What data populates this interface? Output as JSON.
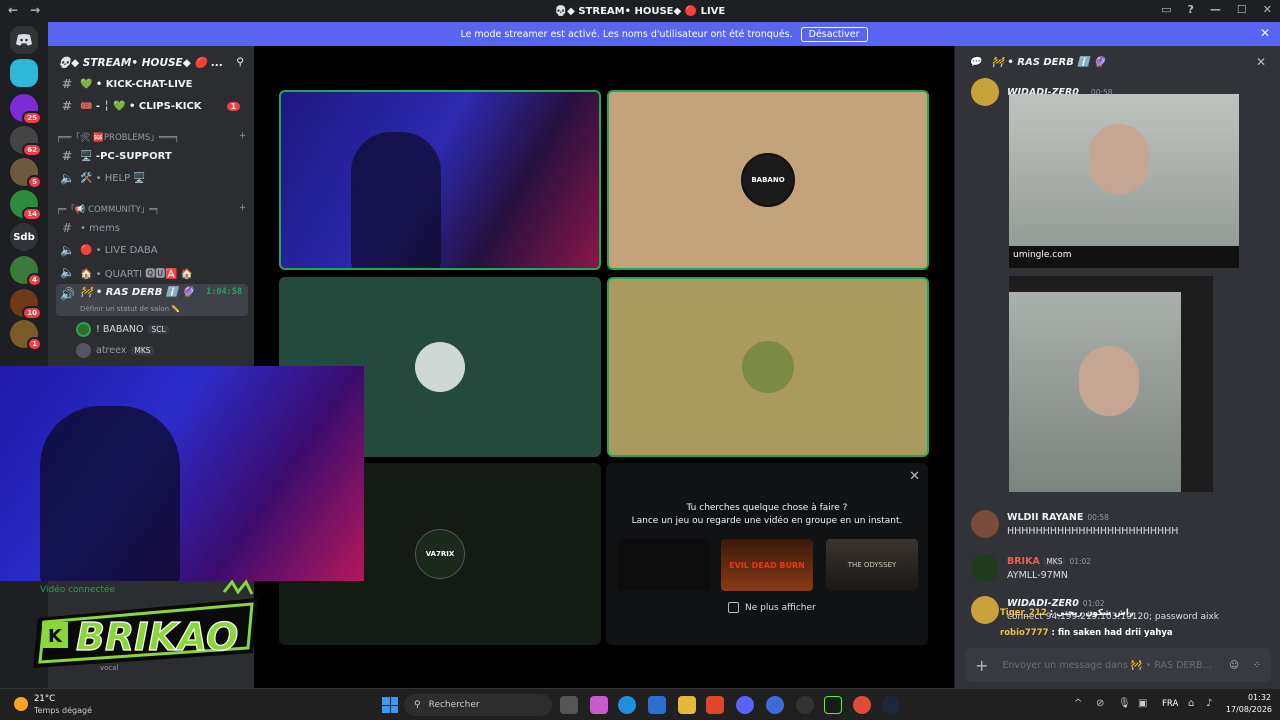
{
  "window": {
    "title": "💀◆ STREAM• HOUSE◆ 🔴 LIVE"
  },
  "banner": {
    "text": "Le mode streamer est activé. Les noms d'utilisateur ont été tronqués.",
    "button": "Désactiver"
  },
  "guilds": [
    {
      "label": "",
      "color": "#2fb7d6",
      "badge": ""
    },
    {
      "label": "",
      "color": "#7d2ad8",
      "badge": "25"
    },
    {
      "label": "",
      "color": "#444",
      "badge": "62"
    },
    {
      "label": "",
      "color": "#6b5a3c",
      "badge": "5"
    },
    {
      "label": "",
      "color": "#2e8b3e",
      "badge": "14"
    },
    {
      "label": "Sdb",
      "color": "#313338",
      "badge": ""
    },
    {
      "label": "",
      "color": "#3c7a3a",
      "badge": "4"
    },
    {
      "label": "",
      "color": "#6e3a1a",
      "badge": "10"
    },
    {
      "label": "",
      "color": "#7a5c2a",
      "badge": "1"
    }
  ],
  "server": {
    "name": "💀◆ STREAM• HOUSE◆ 🔴 ..."
  },
  "channels": {
    "kick_chat": "💚 • KICK-CHAT-LIVE",
    "clips_kick": "🎟️ - ╎ 💚 • CLIPS-KICK",
    "clips_badge": "1",
    "cat_problems": "╒══「🛠 🆘PROBLEMS」═══╕",
    "pc_support": "🖥️ -PC-SUPPORT",
    "help": "🛠️ • HELP 🖥️",
    "cat_community": "╒═「📢 COMMUNITY」═╕",
    "mems": "• mems",
    "live_daba": "🔴 • LIVE DABA",
    "quarti": "🏠 • QUARTI 🆀🆄🅰️ 🏠",
    "ras_derb": "🚧 • RAS DERB ℹ️ 🔮",
    "ras_derb_time": "1:04:58",
    "status_hint": "Définir un statut de salon ✏️"
  },
  "voice_users": [
    {
      "name": "! BABANO",
      "tag": "SCL"
    },
    {
      "name": "atreex",
      "tag": "MKS"
    }
  ],
  "stage": {
    "tiles": [
      "BABANO",
      "",
      "",
      "VA7RIX"
    ],
    "promo_title": "Tu cherches quelque chose à faire ?",
    "promo_sub": "Lance un jeu ou regarde une vidéo en groupe en un instant.",
    "promo_thumbs": [
      "",
      "EVIL DEAD BURN",
      "THE ODYSSEY"
    ],
    "promo_checkbox": "Ne plus afficher"
  },
  "chat": {
    "header": "🚧 • RAS DERB ℹ️ 🔮",
    "messages": [
      {
        "user": "WIDADI-ZER0",
        "time": "00:58",
        "text": "",
        "image_caption": "umingle.com"
      },
      {
        "user": "WLDII RAYANE",
        "time": "00:58",
        "text": "HHHHHHHHHHHHHHHHHHHHHHHH"
      },
      {
        "user": "BRIKA",
        "tag": "MKS",
        "time": "01:02",
        "text": "AYMLL-97MN"
      },
      {
        "user": "WIDADI-ZER0",
        "time": "01:02",
        "text": "connect 94.199.215.103:10120; password aixk"
      }
    ],
    "input_placeholder": "Envoyer un message dans 🚧 • RAS DERB..."
  },
  "overlay_chat": [
    {
      "user": "Tiger_212",
      "text": "راش شكون ريحتي"
    },
    {
      "user": "robio7777",
      "text": "fin saken had drii yahya"
    }
  ],
  "webcam_overlay": {
    "logo": "BRIKAO",
    "voice_label": "Vidéo connectée",
    "voice_sub": "vocal"
  },
  "taskbar": {
    "weather_temp": "21°C",
    "weather_desc": "Temps dégagé",
    "search": "Rechercher",
    "lang": "FRA",
    "time": "01:32",
    "date": "17/08/2026"
  }
}
